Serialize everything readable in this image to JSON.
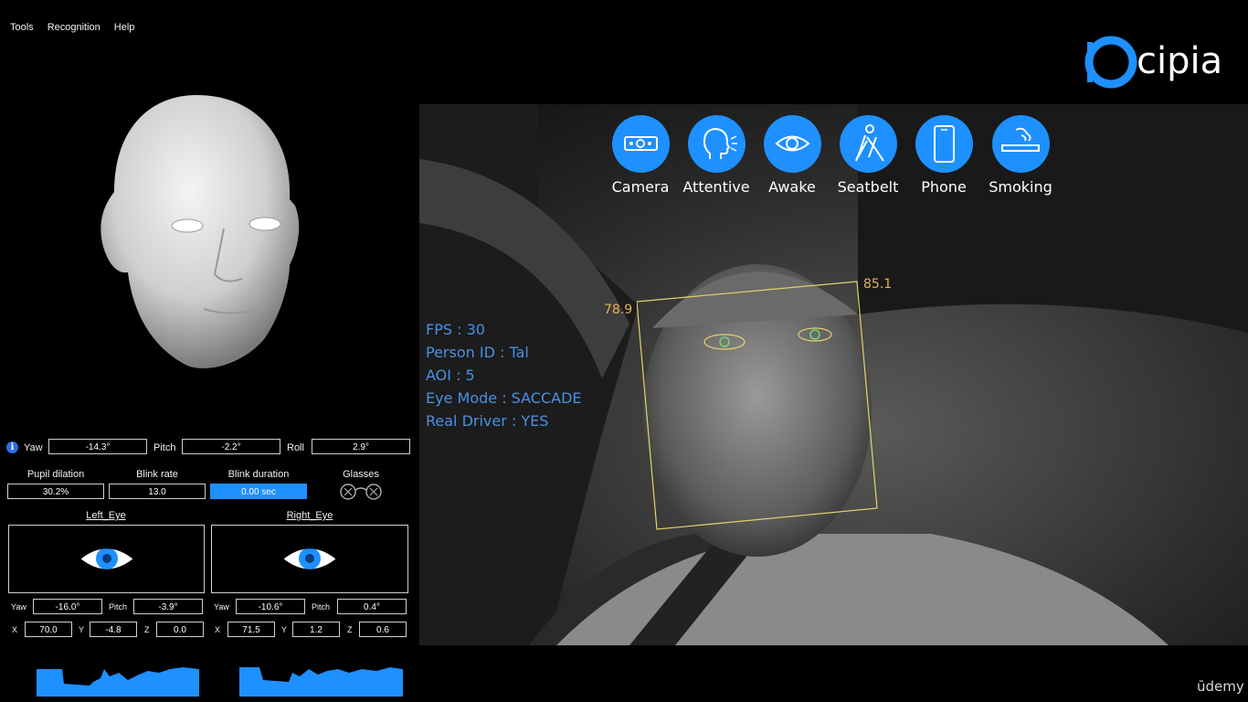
{
  "menu": {
    "items": [
      "Tools",
      "Recognition",
      "Help"
    ]
  },
  "brand": {
    "name": "cipia",
    "color": "#1e90ff"
  },
  "head_pose": {
    "yaw_label": "Yaw",
    "yaw": "-14.3°",
    "pitch_label": "Pitch",
    "pitch": "-2.2°",
    "roll_label": "Roll",
    "roll": "2.9°"
  },
  "metrics": {
    "pupil_label": "Pupil dilation",
    "pupil": "30.2%",
    "blink_rate_label": "Blink rate",
    "blink_rate": "13.0",
    "blink_duration_label": "Blink duration",
    "blink_duration": "0.00 sec",
    "glasses_label": "Glasses"
  },
  "left_eye": {
    "title": "Left_Eye",
    "yaw_label": "Yaw",
    "yaw": "-16.0°",
    "pitch_label": "Pitch",
    "pitch": "-3.9°",
    "x_label": "X",
    "x": "70.0",
    "y_label": "Y",
    "y": "-4.8",
    "z_label": "Z",
    "z": "0.0"
  },
  "right_eye": {
    "title": "Right_Eye",
    "yaw_label": "Yaw",
    "yaw": "-10.6°",
    "pitch_label": "Pitch",
    "pitch": "0.4°",
    "x_label": "X",
    "x": "71.5",
    "y_label": "Y",
    "y": "1.2",
    "z_label": "Z",
    "z": "0.6"
  },
  "overlay": {
    "fps": "FPS : 30",
    "person": "Person ID : Tal",
    "aoi": "AOI : 5",
    "eye_mode": "Eye Mode : SACCADE",
    "real_driver": "Real Driver : YES"
  },
  "status_icons": [
    {
      "label": "Camera",
      "icon": "camera-icon"
    },
    {
      "label": "Attentive",
      "icon": "attentive-icon"
    },
    {
      "label": "Awake",
      "icon": "eye-icon"
    },
    {
      "label": "Seatbelt",
      "icon": "seatbelt-icon"
    },
    {
      "label": "Phone",
      "icon": "phone-icon"
    },
    {
      "label": "Smoking",
      "icon": "smoking-icon"
    }
  ],
  "face_box": {
    "left_score": "78.9",
    "right_score": "85.1",
    "color": "#e6d36a"
  },
  "watermark": "ūdemy"
}
